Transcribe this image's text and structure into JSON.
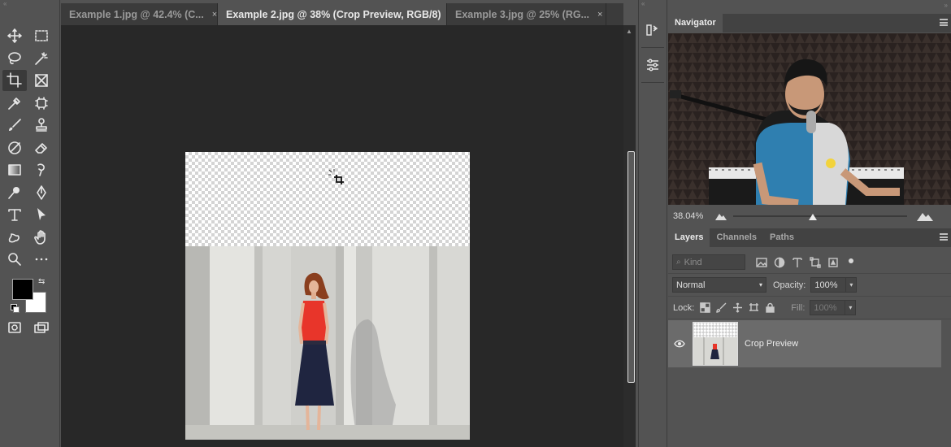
{
  "tabs": [
    {
      "label": "Example 1.jpg @ 42.4% (C...",
      "close": "×",
      "active": false
    },
    {
      "label": "Example 2.jpg @ 38% (Crop Preview, RGB/8)",
      "close": "×",
      "active": true
    },
    {
      "label": "Example 3.jpg @ 25% (RG...",
      "close": "×",
      "active": false
    }
  ],
  "tools": [
    "move-icon",
    "marquee-icon",
    "lasso-icon",
    "magic-wand-icon",
    "crop-icon",
    "frame-icon",
    "eyedropper-icon",
    "patch-icon",
    "brush-icon",
    "stamp-icon",
    "history-brush-icon",
    "eraser-icon",
    "gradient-icon",
    "smudge-icon",
    "dodge-icon",
    "pen-icon",
    "type-icon",
    "path-select-icon",
    "custom-shape-icon",
    "hand-icon",
    "zoom-icon",
    "more-icon"
  ],
  "colors": {
    "foreground": "#000000",
    "background": "#ffffff",
    "swap": "⇆"
  },
  "navigator": {
    "title": "Navigator",
    "zoom": "38.04%",
    "zoom_fraction": 0.38
  },
  "layers_panel": {
    "tabs": [
      "Layers",
      "Channels",
      "Paths"
    ],
    "kind_placeholder": "Kind",
    "blend_mode": "Normal",
    "opacity_label": "Opacity:",
    "opacity_value": "100%",
    "lock_label": "Lock:",
    "fill_label": "Fill:",
    "fill_value": "100%",
    "layers": [
      {
        "name": "Crop Preview",
        "visible": true
      }
    ]
  }
}
